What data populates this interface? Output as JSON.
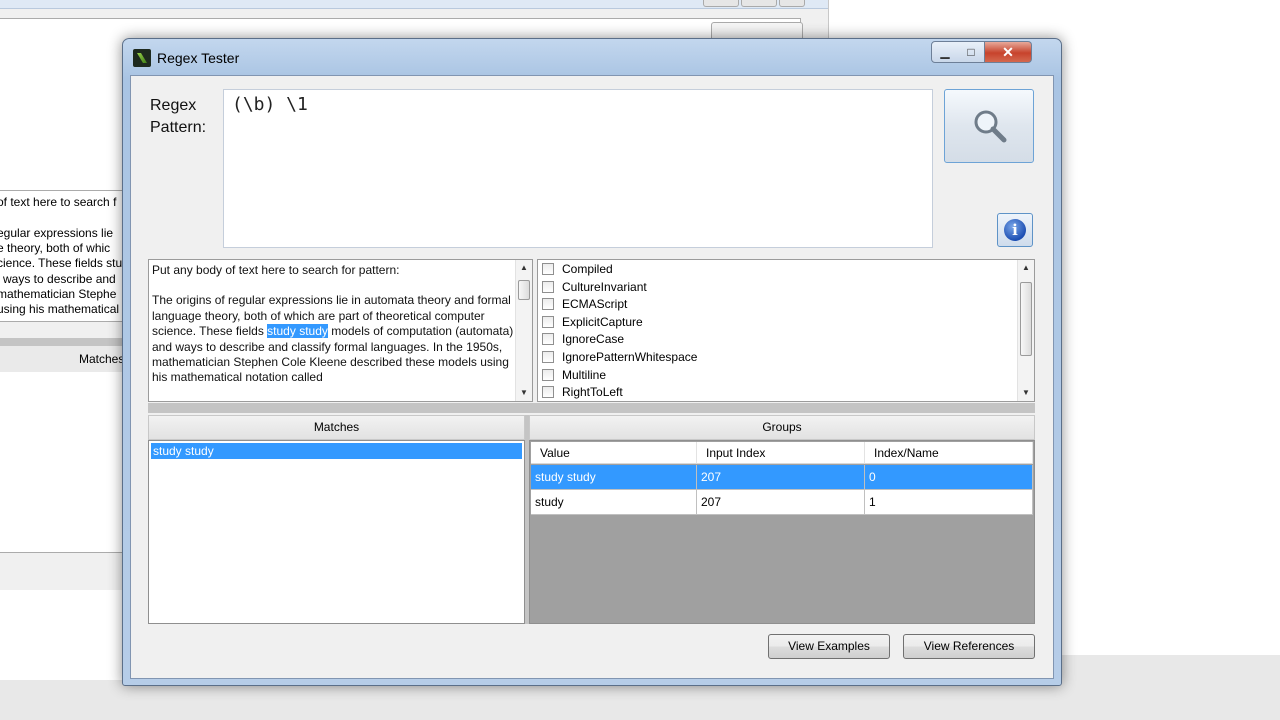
{
  "background_window": {
    "text_lines": [
      "of text here to search f",
      "",
      "egular expressions lie",
      "e theory, both of whic",
      "cience. These fields study",
      "l ways to describe and",
      "mathematician Stephe",
      "using his mathematical"
    ],
    "matches_header": "Matches"
  },
  "window": {
    "title": "Regex Tester",
    "controls": {
      "minimize": "▁",
      "maximize": "□",
      "close": "✕"
    }
  },
  "regex": {
    "label_line1": "Regex",
    "label_line2": "Pattern:",
    "value": "(\\b) \\1"
  },
  "body_text": {
    "line1": "Put any body of text here to search for pattern:",
    "para_before": "The origins of regular expressions lie in automata theory and formal language theory, both of which are part of theoretical computer science. These fields ",
    "highlight": "study study",
    "para_after": " models of computation (automata) and ways to describe and classify formal languages. In the 1950s, mathematician Stephen Cole Kleene described these models using his mathematical notation called"
  },
  "options": [
    {
      "label": "Compiled",
      "checked": false
    },
    {
      "label": "CultureInvariant",
      "checked": false
    },
    {
      "label": "ECMAScript",
      "checked": false
    },
    {
      "label": "ExplicitCapture",
      "checked": false
    },
    {
      "label": "IgnoreCase",
      "checked": false
    },
    {
      "label": "IgnorePatternWhitespace",
      "checked": false
    },
    {
      "label": "Multiline",
      "checked": false
    },
    {
      "label": "RightToLeft",
      "checked": false
    }
  ],
  "matches": {
    "header": "Matches",
    "items": [
      "study study"
    ]
  },
  "groups": {
    "header": "Groups",
    "columns": [
      "Value",
      "Input Index",
      "Index/Name"
    ],
    "rows": [
      {
        "value": "study study",
        "input_index": "207",
        "index_name": "0",
        "selected": true
      },
      {
        "value": "study",
        "input_index": "207",
        "index_name": "1",
        "selected": false
      }
    ]
  },
  "buttons": {
    "view_examples": "View Examples",
    "view_references": "View References"
  },
  "colors": {
    "selection": "#3399ff",
    "grid_background": "#a0a0a0",
    "close_button": "#c7432c"
  }
}
